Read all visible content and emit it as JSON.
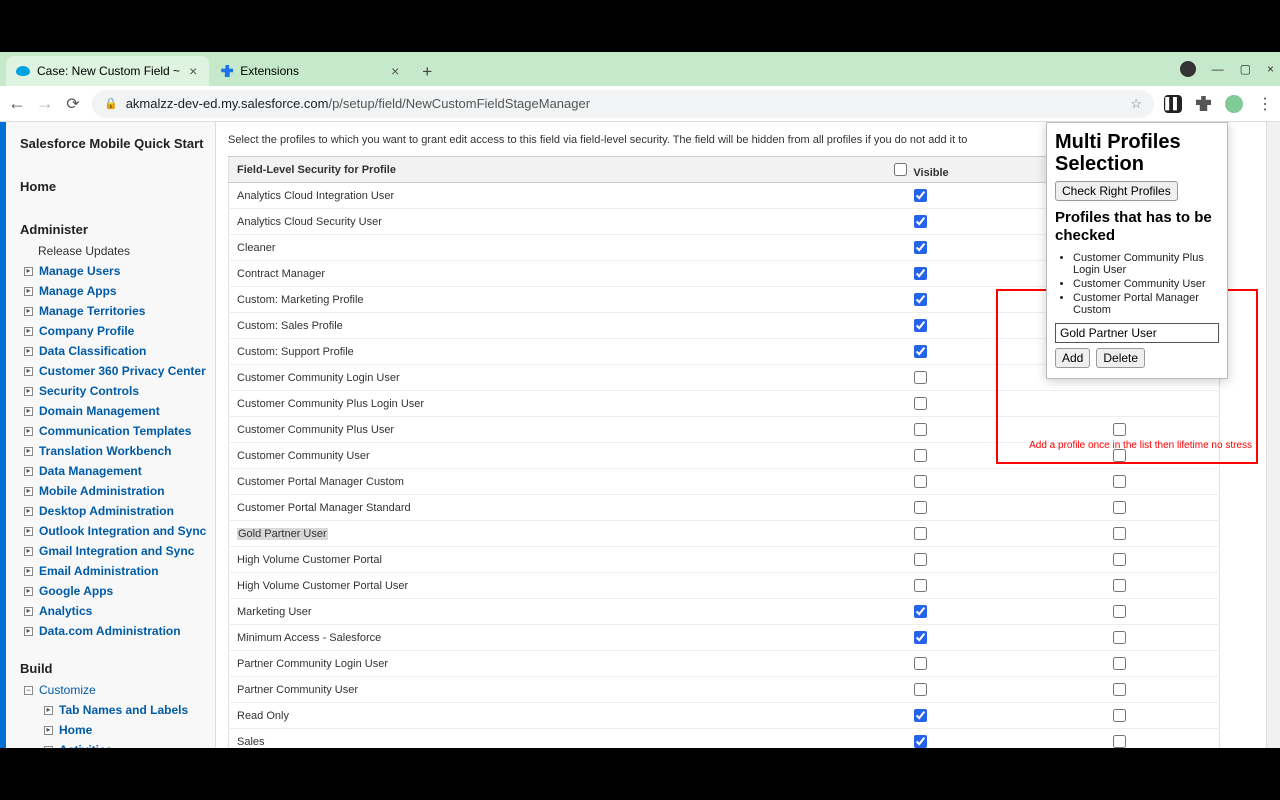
{
  "tabs": [
    {
      "title": "Case: New Custom Field ~",
      "active": true
    },
    {
      "title": "Extensions",
      "active": false
    }
  ],
  "url_host": "akmalzz-dev-ed.my.salesforce.com",
  "url_path": "/p/setup/field/NewCustomFieldStageManager",
  "sidebar": {
    "quick_start": "Salesforce Mobile Quick Start",
    "home": "Home",
    "administer": "Administer",
    "admin_items": [
      "Release Updates",
      "Manage Users",
      "Manage Apps",
      "Manage Territories",
      "Company Profile",
      "Data Classification",
      "Customer 360 Privacy Center",
      "Security Controls",
      "Domain Management",
      "Communication Templates",
      "Translation Workbench",
      "Data Management",
      "Mobile Administration",
      "Desktop Administration",
      "Outlook Integration and Sync",
      "Gmail Integration and Sync",
      "Email Administration",
      "Google Apps",
      "Analytics",
      "Data.com Administration"
    ],
    "build": "Build",
    "build_root": "Customize",
    "build_items": [
      "Tab Names and Labels",
      "Home",
      "Activities"
    ]
  },
  "intro": "Select the profiles to which you want to grant edit access to this field via field-level security. The field will be hidden from all profiles if you do not add it to",
  "table": {
    "header_left": "Field-Level Security for Profile",
    "header_visible": "Visible",
    "rows": [
      {
        "name": "Analytics Cloud Integration User",
        "v": true,
        "r": false,
        "showR": false
      },
      {
        "name": "Analytics Cloud Security User",
        "v": true,
        "r": false,
        "showR": false
      },
      {
        "name": "Cleaner",
        "v": true,
        "r": false,
        "showR": false
      },
      {
        "name": "Contract Manager",
        "v": true,
        "r": false,
        "showR": false
      },
      {
        "name": "Custom: Marketing Profile",
        "v": true,
        "r": false,
        "showR": false
      },
      {
        "name": "Custom: Sales Profile",
        "v": true,
        "r": false,
        "showR": false
      },
      {
        "name": "Custom: Support Profile",
        "v": true,
        "r": false,
        "showR": false
      },
      {
        "name": "Customer Community Login User",
        "v": false,
        "r": false,
        "showR": false
      },
      {
        "name": "Customer Community Plus Login User",
        "v": false,
        "r": false,
        "showR": false
      },
      {
        "name": "Customer Community Plus User",
        "v": false,
        "r": false,
        "showR": false,
        "rPeek": true
      },
      {
        "name": "Customer Community User",
        "v": false,
        "r": false,
        "showR": true
      },
      {
        "name": "Customer Portal Manager Custom",
        "v": false,
        "r": false,
        "showR": true
      },
      {
        "name": "Customer Portal Manager Standard",
        "v": false,
        "r": false,
        "showR": true
      },
      {
        "name": "Gold Partner User",
        "v": false,
        "r": false,
        "showR": true,
        "hl": true
      },
      {
        "name": "High Volume Customer Portal",
        "v": false,
        "r": false,
        "showR": true
      },
      {
        "name": "High Volume Customer Portal User",
        "v": false,
        "r": false,
        "showR": true
      },
      {
        "name": "Marketing User",
        "v": true,
        "r": false,
        "showR": true
      },
      {
        "name": "Minimum Access - Salesforce",
        "v": true,
        "r": false,
        "showR": true
      },
      {
        "name": "Partner Community Login User",
        "v": false,
        "r": false,
        "showR": true
      },
      {
        "name": "Partner Community User",
        "v": false,
        "r": false,
        "showR": true
      },
      {
        "name": "Read Only",
        "v": true,
        "r": false,
        "showR": true
      },
      {
        "name": "Sales",
        "v": true,
        "r": false,
        "showR": true
      }
    ]
  },
  "popup": {
    "title": "Multi Profiles Selection",
    "check_btn": "Check Right Profiles",
    "subtitle": "Profiles that has to be checked",
    "items": [
      "Customer Community Plus Login User",
      "Customer Community User",
      "Customer Portal Manager Custom"
    ],
    "input_value": "Gold Partner User",
    "add": "Add",
    "delete": "Delete"
  },
  "red_note": "Add a profile once in the list then lifetime no stress"
}
